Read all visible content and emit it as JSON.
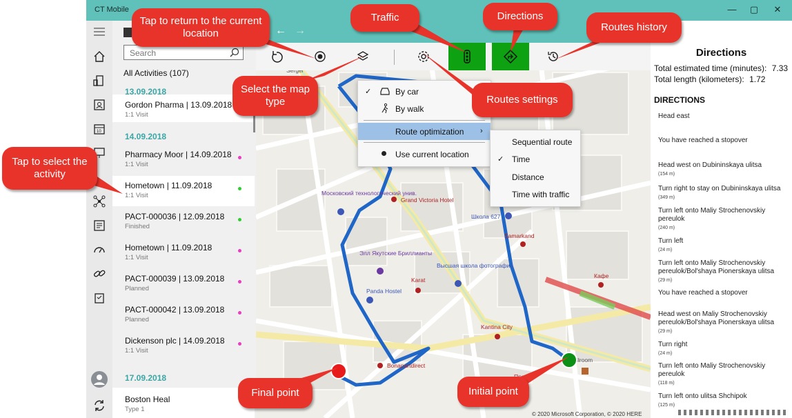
{
  "app": {
    "title": "CT Mobile",
    "minimize": "—",
    "restore": "▢",
    "close": "✕"
  },
  "search": {
    "placeholder": "Search"
  },
  "list": {
    "header": "All Activities (107)",
    "groups": [
      {
        "date": "13.09.2018"
      },
      {
        "date": "14.09.2018"
      },
      {
        "date": "17.09.2018"
      }
    ],
    "items": [
      {
        "title": "Gordon Pharma | 13.09.2018",
        "subtitle": "1:1 Visit"
      },
      {
        "title": "Pharmacy Moor | 14.09.2018",
        "subtitle": "1:1 Visit",
        "dot": "#e83fbf"
      },
      {
        "title": "Hometown | 11.09.2018",
        "subtitle": "1:1 Visit",
        "dot": "#2fcf2f"
      },
      {
        "title": "PACT-000036 | 12.09.2018",
        "subtitle": "Finished",
        "dot": "#2fcf2f"
      },
      {
        "title": "Hometown | 11.09.2018",
        "subtitle": "1:1 Visit",
        "dot": "#e83fbf"
      },
      {
        "title": "PACT-000039 | 13.09.2018",
        "subtitle": "Planned",
        "dot": "#e83fbf"
      },
      {
        "title": "PACT-000042 | 13.09.2018",
        "subtitle": "Planned",
        "dot": "#e83fbf"
      },
      {
        "title": "Dickenson plc | 14.09.2018",
        "subtitle": "1:1 Visit",
        "dot": "#e83fbf"
      },
      {
        "title": "Boston Heal",
        "subtitle": "Type 1"
      }
    ]
  },
  "map_menu": {
    "by_car": "By car",
    "by_walk": "By walk",
    "route_optimization": "Route optimization",
    "use_current_location": "Use current location"
  },
  "optimization_menu": {
    "sequential": "Sequential route",
    "time": "Time",
    "distance": "Distance",
    "time_traffic": "Time with traffic"
  },
  "map_labels": {
    "l1": "Московский технологический унив.",
    "l2": "Grand Victoria Hotel",
    "l3": "Школа 627",
    "l4": "Samarkand",
    "l5": "Элл Якутские Бриллианты",
    "l6": "Высшая школа фотографии",
    "l7": "Karat",
    "l8": "Kafe",
    "l9": "Panda Hostel",
    "l10": "Kantina City",
    "l11": "Bonapartdirect",
    "l12": "Кафе",
    "l13": "Sergei",
    "l14": "ilroom",
    "l15": "Прав",
    "copyright": "© 2020 Microsoft Corporation, © 2020 HERE"
  },
  "directions": {
    "title": "Directions",
    "total_time_label": "Total estimated time (minutes):",
    "total_time": "7.33",
    "total_length_label": "Total length (kilometers):",
    "total_length": "1.72",
    "heading": "DIRECTIONS",
    "steps": [
      {
        "text": "Head east",
        "dist": ""
      },
      {
        "text": "You have reached a stopover",
        "dist": ""
      },
      {
        "text": "Head west on Dubininskaya ulitsa",
        "dist": "(154 m)"
      },
      {
        "text": "Turn right to stay on Dubininskaya ulitsa",
        "dist": "(349 m)"
      },
      {
        "text": "Turn left onto Maliy Strochenovskiy pereulok",
        "dist": "(240 m)"
      },
      {
        "text": "Turn left",
        "dist": "(24 m)"
      },
      {
        "text": "Turn left onto Maliy Strochenovskiy pereulok/Bol'shaya Pionerskaya ulitsa",
        "dist": "(29 m)"
      },
      {
        "text": "You have reached a stopover",
        "dist": ""
      },
      {
        "text": "Head west on Maliy Strochenovskiy pereulok/Bol'shaya Pionerskaya ulitsa",
        "dist": "(29 m)"
      },
      {
        "text": "Turn right",
        "dist": "(24 m)"
      },
      {
        "text": "Turn left onto Maliy Strochenovskiy pereulok",
        "dist": "(118 m)"
      },
      {
        "text": "Turn left onto ulitsa Shchipok",
        "dist": "(125 m)"
      }
    ]
  },
  "callouts": {
    "return": "Tap to return to the current location",
    "traffic": "Traffic",
    "directions": "Directions",
    "history": "Routes history",
    "map_type": "Select the map type",
    "settings": "Routes settings",
    "select_activity": "Tap to select the activity",
    "final_point": "Final point",
    "initial_point": "Initial point"
  },
  "colors": {
    "accent": "#5fc1b9",
    "callout": "#e8332a",
    "route": "#1f66c6",
    "active_tool": "#0ea111",
    "final_point": "#e81b1b",
    "initial_point": "#0b8f15"
  }
}
